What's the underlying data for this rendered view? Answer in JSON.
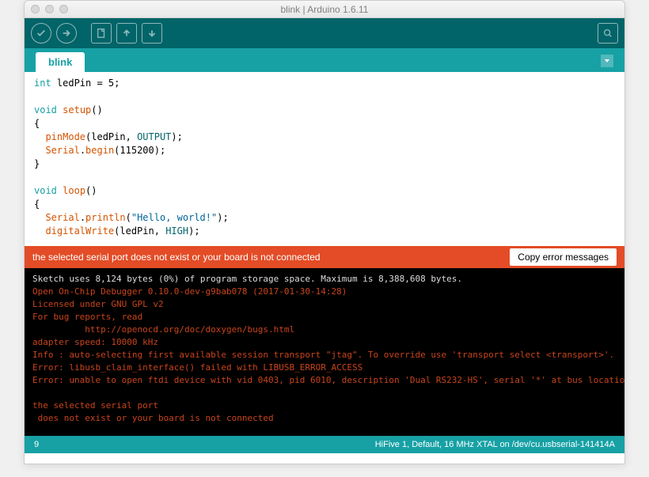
{
  "window": {
    "title": "blink | Arduino 1.6.11"
  },
  "tab": {
    "name": "blink"
  },
  "code": {
    "l1a": "int",
    "l1b": " ledPin = 5;",
    "l3a": "void",
    "l3b": " ",
    "l3c": "setup",
    "l3d": "()",
    "l4": "{",
    "l5a": "  ",
    "l5b": "pinMode",
    "l5c": "(ledPin, ",
    "l5d": "OUTPUT",
    "l5e": ");",
    "l6a": "  ",
    "l6b": "Serial",
    "l6c": ".",
    "l6d": "begin",
    "l6e": "(115200);",
    "l7": "}",
    "l9a": "void",
    "l9b": " ",
    "l9c": "loop",
    "l9d": "()",
    "l10": "{",
    "l11a": "  ",
    "l11b": "Serial",
    "l11c": ".",
    "l11d": "println",
    "l11e": "(",
    "l11f": "\"Hello, world!\"",
    "l11g": ");",
    "l12a": "  ",
    "l12b": "digitalWrite",
    "l12c": "(ledPin, ",
    "l12d": "HIGH",
    "l12e": ");"
  },
  "errorbar": {
    "message": "the selected serial port   does not exist or your board is not connected",
    "button": "Copy error messages"
  },
  "console": {
    "l1": "Sketch uses 8,124 bytes (0%) of program storage space. Maximum is 8,388,608 bytes.",
    "l2": "Open On-Chip Debugger 0.10.0-dev-g9bab078 (2017-01-30-14:28)",
    "l3": "Licensed under GNU GPL v2",
    "l4": "For bug reports, read",
    "l5": "          http://openocd.org/doc/doxygen/bugs.html",
    "l6": "adapter speed: 10000 kHz",
    "l7": "Info : auto-selecting first available session transport \"jtag\". To override use 'transport select <transport>'.",
    "l8": "Error: libusb_claim_interface() failed with LIBUSB_ERROR_ACCESS",
    "l9": "Error: unable to open ftdi device with vid 0403, pid 6010, description 'Dual RS232-HS', serial '*' at bus location '*'",
    "l11": "the selected serial port ",
    "l12": " does not exist or your board is not connected"
  },
  "status": {
    "line": "9",
    "board": "HiFive 1, Default, 16 MHz XTAL on /dev/cu.usbserial-141414A"
  }
}
